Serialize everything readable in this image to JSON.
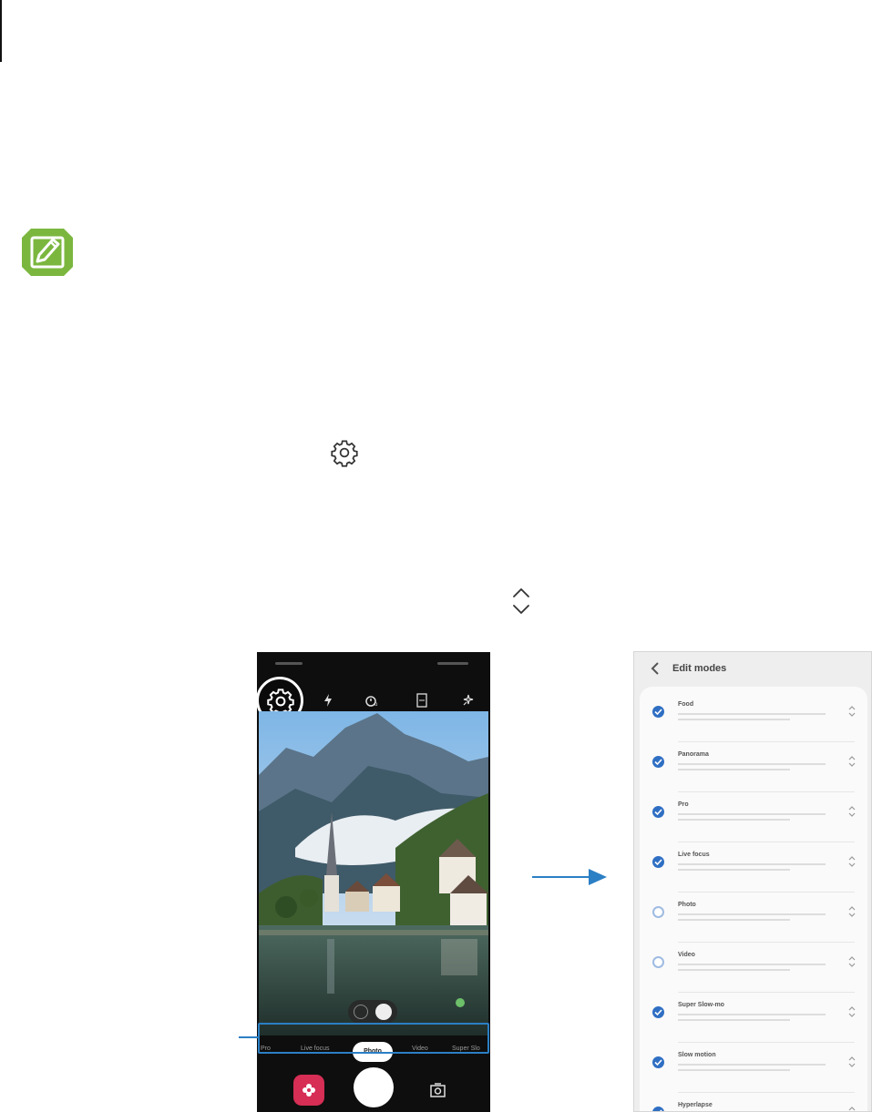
{
  "icons": {
    "note": "pencil-note-icon",
    "inline_settings": "gear-icon",
    "inline_reorder": "up-down-chevron-icon"
  },
  "colors": {
    "note_green": "#7bb73f",
    "callout_blue": "#2b7fc4",
    "check_blue": "#2f6fc3",
    "bixby_red": "#d62e55"
  },
  "camera": {
    "toolbar_icons": [
      "gear-icon",
      "flash-icon",
      "timer-icon",
      "ratio-icon",
      "effects-icon"
    ],
    "modes": [
      "Pro",
      "Live focus",
      "Photo",
      "Video",
      "Super Slo"
    ],
    "selected_mode_index": 2
  },
  "edit_modes": {
    "title": "Edit modes",
    "items": [
      {
        "title": "Food",
        "checked": true
      },
      {
        "title": "Panorama",
        "checked": true
      },
      {
        "title": "Pro",
        "checked": true
      },
      {
        "title": "Live focus",
        "checked": true
      },
      {
        "title": "Photo",
        "checked": false
      },
      {
        "title": "Video",
        "checked": false
      },
      {
        "title": "Super Slow-mo",
        "checked": true
      },
      {
        "title": "Slow motion",
        "checked": true
      },
      {
        "title": "Hyperlapse",
        "checked": true
      }
    ]
  }
}
